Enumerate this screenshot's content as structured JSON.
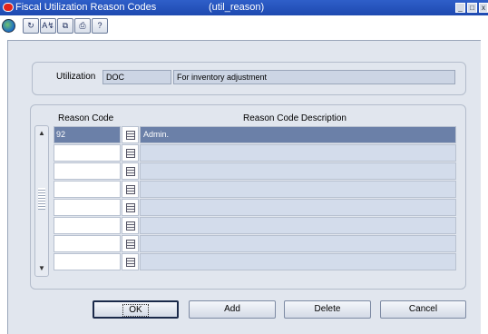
{
  "window": {
    "title": "Fiscal Utilization Reason Codes",
    "code": "(util_reason)",
    "minimize": "_",
    "maximize": "□",
    "close": "x"
  },
  "toolbar": {
    "icons": [
      "globe-icon",
      "sync-icon",
      "spell-check-icon",
      "copy-icon",
      "print-icon",
      "help-icon"
    ],
    "globe_label": "",
    "sync_glyph": "↻",
    "spell_glyph": "A↯",
    "copy_glyph": "⧉",
    "print_glyph": "⎙",
    "help_glyph": "?"
  },
  "utilization": {
    "label": "Utilization",
    "code": "DOC",
    "description": "For inventory adjustment"
  },
  "grid": {
    "header_code": "Reason Code",
    "header_desc": "Reason Code Description",
    "rows": [
      {
        "code": "92",
        "desc": "Admin."
      },
      {
        "code": "",
        "desc": ""
      },
      {
        "code": "",
        "desc": ""
      },
      {
        "code": "",
        "desc": ""
      },
      {
        "code": "",
        "desc": ""
      },
      {
        "code": "",
        "desc": ""
      },
      {
        "code": "",
        "desc": ""
      },
      {
        "code": "",
        "desc": ""
      }
    ]
  },
  "scroll": {
    "up": "▲",
    "down": "▼"
  },
  "buttons": {
    "ok": "OK",
    "add": "Add",
    "delete": "Delete",
    "cancel": "Cancel"
  },
  "colors": {
    "titlebar": "#1e49b0",
    "frame": "#e1e6ee",
    "selected_row": "#6b80a8"
  }
}
